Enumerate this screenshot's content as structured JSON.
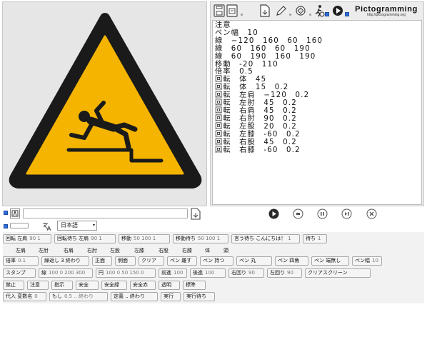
{
  "brand": {
    "name": "Pictogramming",
    "url": "http://pictogramming.org"
  },
  "code_lines": [
    "注意",
    "ペン幅　10",
    "線　−120　160　60　160",
    "線　60　160　60　190",
    "線　60　190　160　190",
    "移動　-20　110",
    "倍率　0.5",
    "回転　体　45",
    "回転　体　15　0.2",
    "回転　左肩　−120　0.2",
    "回転　左肘　45　0.2",
    "回転　右肩　45　0.2",
    "回転　右肘　90　0.2",
    "回転　左股　20　0.2",
    "回転　左膝　-60　0.2",
    "回転　右股　45　0.2",
    "回転　右膝　-60　0.2"
  ],
  "language": {
    "selected": "日本語"
  },
  "colors": {
    "sign_yellow": "#f4b400",
    "sign_black": "#1a1a1a",
    "accent_blue": "#2f6fd8"
  },
  "row1": [
    {
      "label": "回転 左肩",
      "arg": "90 1"
    },
    {
      "label": "回転待ち 左肩",
      "arg": "90 1"
    },
    {
      "label": "移動",
      "arg": "50 100 1"
    },
    {
      "label": "移動待ち",
      "arg": "50 100 1"
    },
    {
      "label": "言う待ち こんにちは！",
      "arg": "1"
    },
    {
      "label": "待ち",
      "arg": "1"
    }
  ],
  "parts": [
    "左肩",
    "左肘",
    "右肩",
    "右肘",
    "左股",
    "左膝",
    "右股",
    "右膝",
    "体",
    "頭"
  ],
  "row2": [
    {
      "label": "倍率",
      "arg": "0.1"
    },
    {
      "label": "繰返し 3 終わり",
      "arg": ""
    },
    {
      "label": "正面",
      "arg": ""
    },
    {
      "label": "側面",
      "arg": ""
    },
    {
      "label": "クリア",
      "arg": ""
    },
    {
      "label": "ペン 離す",
      "arg": ""
    },
    {
      "label": "ペン 持つ",
      "arg": ""
    },
    {
      "label": "ペン 丸",
      "arg": ""
    },
    {
      "label": "ペン 四角",
      "arg": ""
    },
    {
      "label": "ペン 端無し",
      "arg": ""
    },
    {
      "label": "ペン幅",
      "arg": "10"
    }
  ],
  "row3": [
    {
      "label": "スタンプ",
      "arg": ""
    },
    {
      "label": "線",
      "arg": "100 0 200 300"
    },
    {
      "label": "円",
      "arg": "100 0 50 150 0"
    },
    {
      "label": "前進",
      "arg": "100"
    },
    {
      "label": "後進",
      "arg": "100"
    },
    {
      "label": "右回り",
      "arg": "90"
    },
    {
      "label": "左回り",
      "arg": "90"
    },
    {
      "label": "クリアスクリーン",
      "arg": ""
    }
  ],
  "row4": [
    {
      "label": "禁止",
      "arg": ""
    },
    {
      "label": "注意",
      "arg": ""
    },
    {
      "label": "指示",
      "arg": ""
    },
    {
      "label": "安全",
      "arg": ""
    },
    {
      "label": "安全緑",
      "arg": ""
    },
    {
      "label": "安全赤",
      "arg": ""
    },
    {
      "label": "透明",
      "arg": ""
    },
    {
      "label": "標準",
      "arg": ""
    }
  ],
  "row5": [
    {
      "label": "代入 変数名",
      "arg": "0"
    },
    {
      "label": "もし",
      "arg": "0.5 .. 終わり"
    },
    {
      "label": "定義 .. 終わり",
      "arg": ""
    },
    {
      "label": "実行",
      "arg": ""
    },
    {
      "label": "実行待ち",
      "arg": ""
    }
  ]
}
